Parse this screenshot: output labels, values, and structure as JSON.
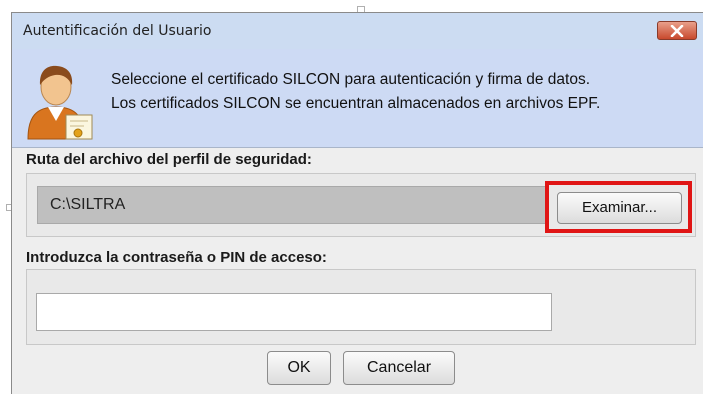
{
  "dialog": {
    "title": "Autentificación del Usuario",
    "close_icon": "close-x-icon",
    "user_icon": "user-certificate-icon"
  },
  "header": {
    "line1": "Seleccione el certificado SILCON para autenticación y firma de datos.",
    "line2": "Los certificados SILCON se encuentran almacenados en archivos EPF."
  },
  "security_profile": {
    "label": "Ruta del archivo del perfil de seguridad:",
    "path_value": "C:\\SILTRA",
    "browse_label": "Examinar..."
  },
  "pin": {
    "label": "Introduzca la contraseña o PIN de acceso:",
    "value": ""
  },
  "buttons": {
    "ok_label": "OK",
    "cancel_label": "Cancelar"
  },
  "colors": {
    "highlight": "#e01515",
    "header_bg": "#cddaf4",
    "close_button": "#c8492d"
  }
}
